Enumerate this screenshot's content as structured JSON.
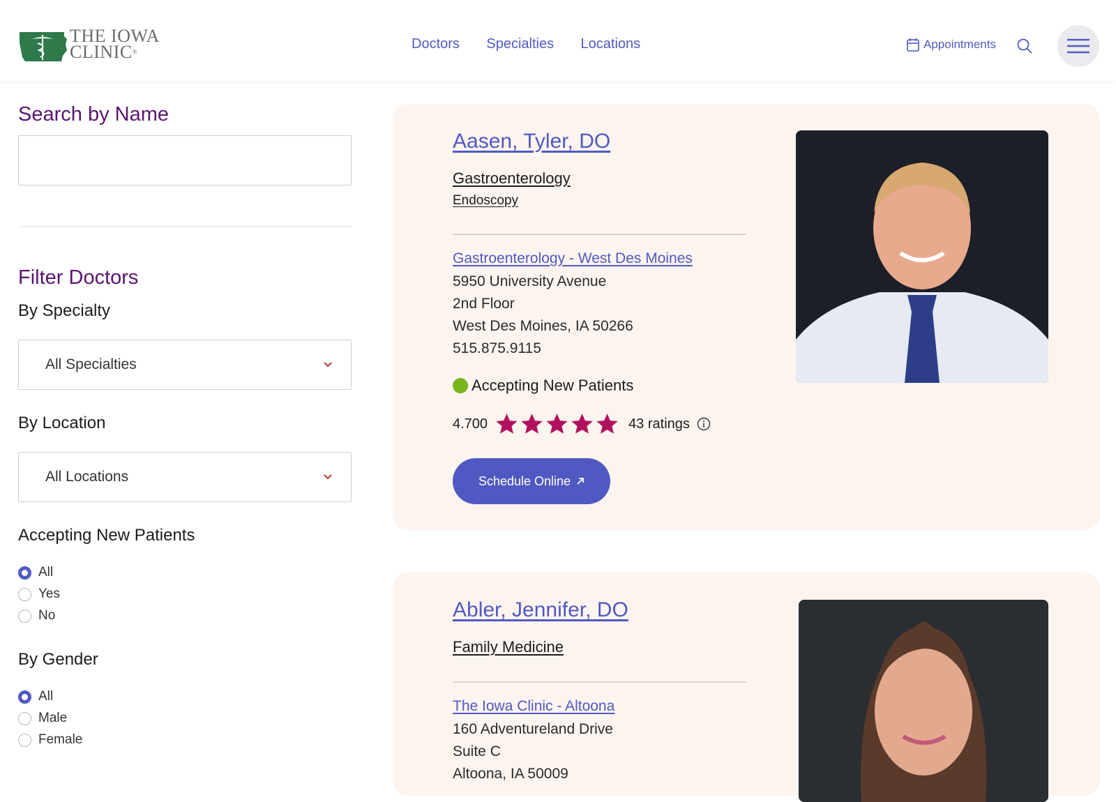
{
  "header": {
    "logo_line1": "THE IOWA",
    "logo_line2": "CLINIC",
    "logo_reg": "®",
    "nav": [
      "Doctors",
      "Specialties",
      "Locations"
    ],
    "appointments_label": "Appointments"
  },
  "sidebar": {
    "search_title": "Search by Name",
    "search_value": "",
    "filter_title": "Filter Doctors",
    "specialty_label": "By Specialty",
    "specialty_value": "All Specialties",
    "location_label": "By Location",
    "location_value": "All Locations",
    "accepting_label": "Accepting New Patients",
    "accepting_options": [
      "All",
      "Yes",
      "No"
    ],
    "accepting_selected": "All",
    "gender_label": "By Gender",
    "gender_options": [
      "All",
      "Male",
      "Female"
    ],
    "gender_selected": "All"
  },
  "doctors": [
    {
      "name": "Aasen, Tyler, DO",
      "specialties": [
        "Gastroenterology",
        "Endoscopy"
      ],
      "location_name": "Gastroenterology - West Des Moines",
      "address": [
        "5950 University Avenue",
        "2nd Floor",
        "West Des Moines, IA 50266",
        "515.875.9115"
      ],
      "accepting": "Accepting New Patients",
      "rating": "4.700",
      "stars": 5,
      "ratings_count": "43 ratings",
      "schedule_label": "Schedule Online"
    },
    {
      "name": "Abler, Jennifer, DO",
      "specialties": [
        "Family Medicine"
      ],
      "location_name": "The Iowa Clinic - Altoona",
      "address": [
        "160 Adventureland Drive",
        "Suite C",
        "Altoona, IA 50009"
      ]
    }
  ],
  "colors": {
    "brand_purple": "#5a1570",
    "link_blue": "#5059c2",
    "card_bg": "#fcf4ef",
    "star": "#b0115f",
    "accepting_green": "#79b51c",
    "logo_green": "#2e7a4a"
  }
}
